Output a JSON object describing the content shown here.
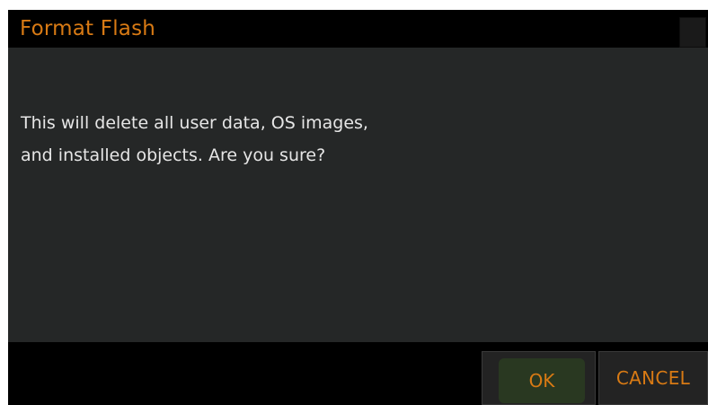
{
  "dialog": {
    "title": "Format Flash",
    "message_lines": [
      "This will delete all user data, OS images,",
      "and installed objects. Are you sure?"
    ],
    "buttons": {
      "ok_label": "OK",
      "cancel_label": "CANCEL"
    }
  },
  "colors": {
    "accent": "#d87a14",
    "background": "#252727",
    "titlebar": "#000000",
    "ok_button_bg": "#293821"
  }
}
